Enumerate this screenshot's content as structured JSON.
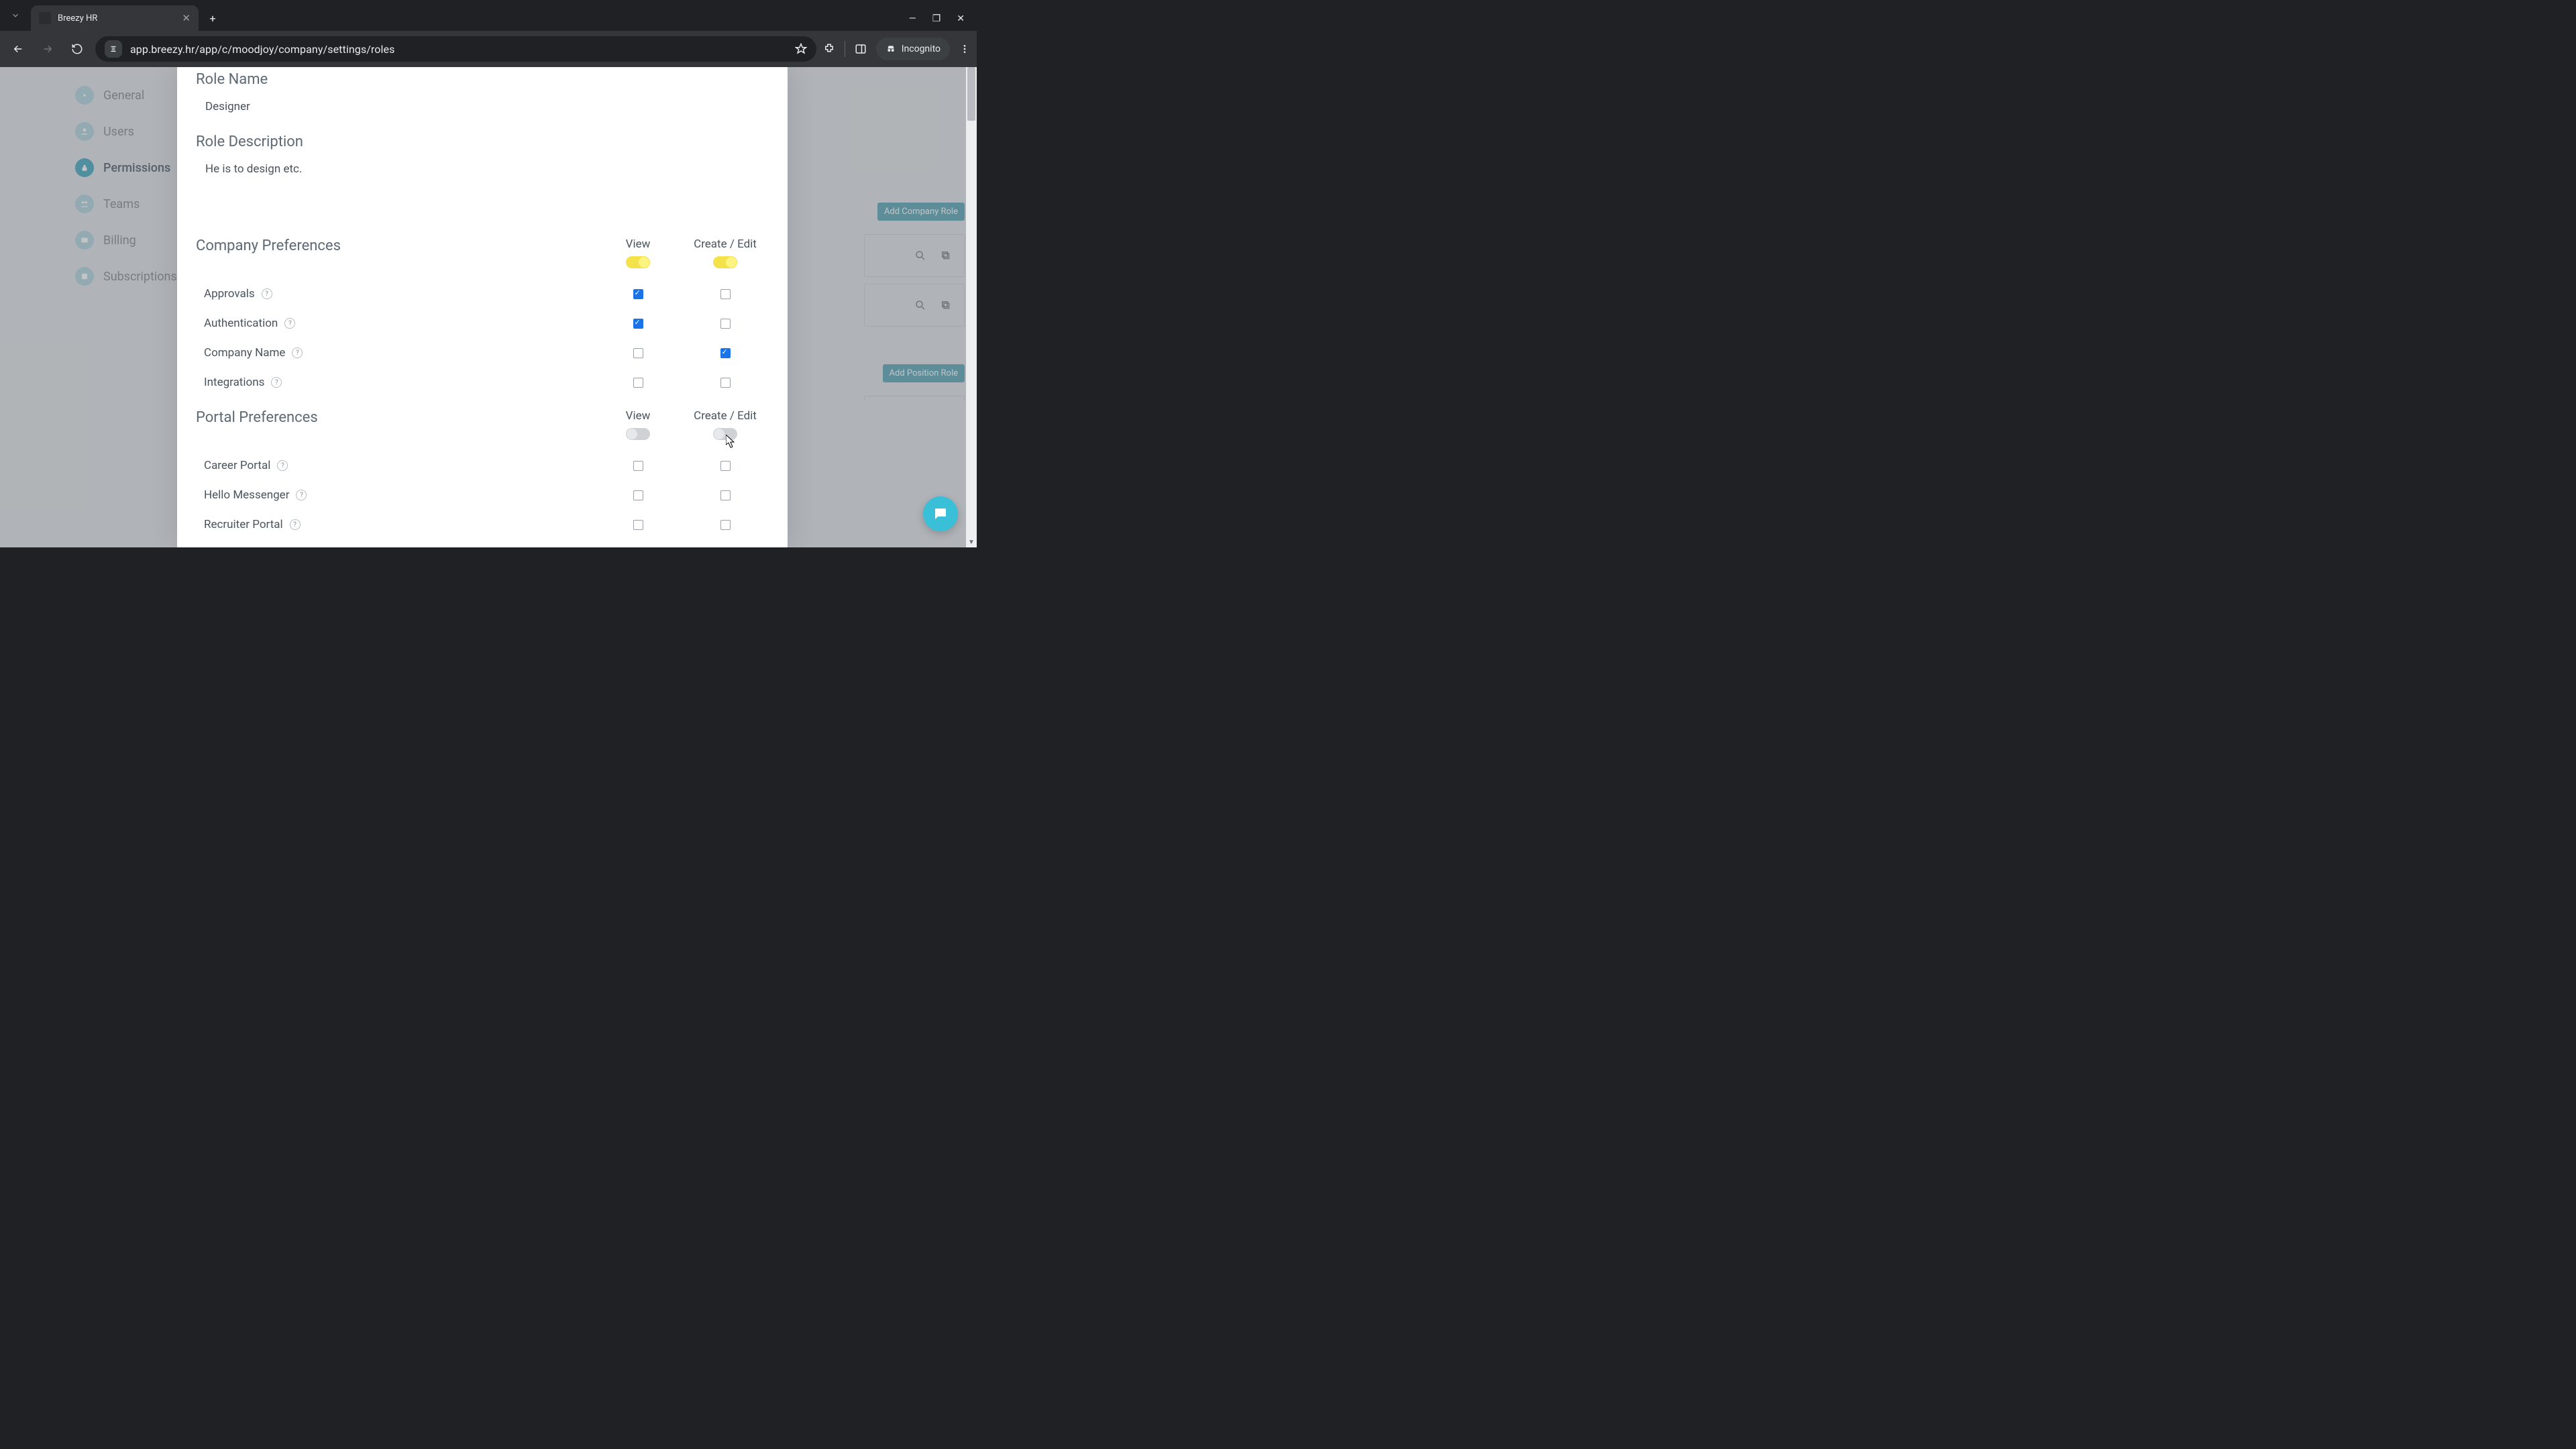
{
  "browser": {
    "tab_title": "Breezy HR",
    "url_display": "app.breezy.hr/app/c/moodjoy/company/settings/roles",
    "incognito_label": "Incognito"
  },
  "sidebar": {
    "items": [
      {
        "label": "General"
      },
      {
        "label": "Users"
      },
      {
        "label": "Permissions"
      },
      {
        "label": "Teams"
      },
      {
        "label": "Billing"
      },
      {
        "label": "Subscriptions"
      }
    ]
  },
  "bg": {
    "add_company_role": "Add Company Role",
    "add_position_role": "Add Position Role"
  },
  "modal": {
    "role_name_label": "Role Name",
    "role_name_value": "Designer",
    "role_desc_label": "Role Description",
    "role_desc_value": "He is to design etc.",
    "col_view": "View",
    "col_edit": "Create / Edit",
    "sections": {
      "company": {
        "title": "Company Preferences",
        "view_toggle": true,
        "edit_toggle": true,
        "rows": [
          {
            "label": "Approvals",
            "view": true,
            "edit": false
          },
          {
            "label": "Authentication",
            "view": true,
            "edit": false
          },
          {
            "label": "Company Name",
            "view": false,
            "edit": true
          },
          {
            "label": "Integrations",
            "view": false,
            "edit": false
          }
        ]
      },
      "portal": {
        "title": "Portal Preferences",
        "view_toggle": false,
        "edit_toggle": false,
        "rows": [
          {
            "label": "Career Portal",
            "view": false,
            "edit": false
          },
          {
            "label": "Hello Messenger",
            "view": false,
            "edit": false
          },
          {
            "label": "Recruiter Portal",
            "view": false,
            "edit": false
          }
        ]
      }
    }
  }
}
